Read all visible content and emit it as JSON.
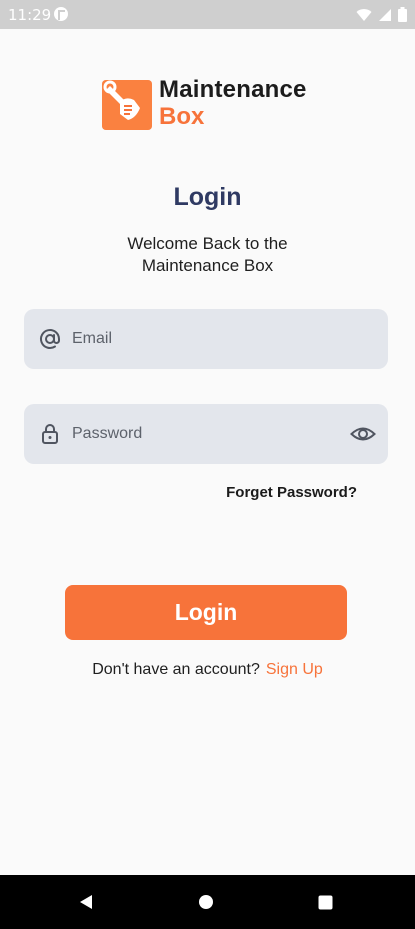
{
  "status_bar": {
    "time": "11:29"
  },
  "logo": {
    "line1": "Maintenance",
    "line2": "Box"
  },
  "login": {
    "title": "Login",
    "subtitle_line1": "Welcome Back to the",
    "subtitle_line2": "Maintenance Box",
    "email_placeholder": "Email",
    "password_placeholder": "Password",
    "forget_password": "Forget Password?",
    "login_button": "Login",
    "no_account_text": "Don't have an account?",
    "signup_link": "Sign Up"
  },
  "colors": {
    "accent": "#f7733a",
    "title": "#2f3a63",
    "field_bg": "#e3e6ec"
  }
}
